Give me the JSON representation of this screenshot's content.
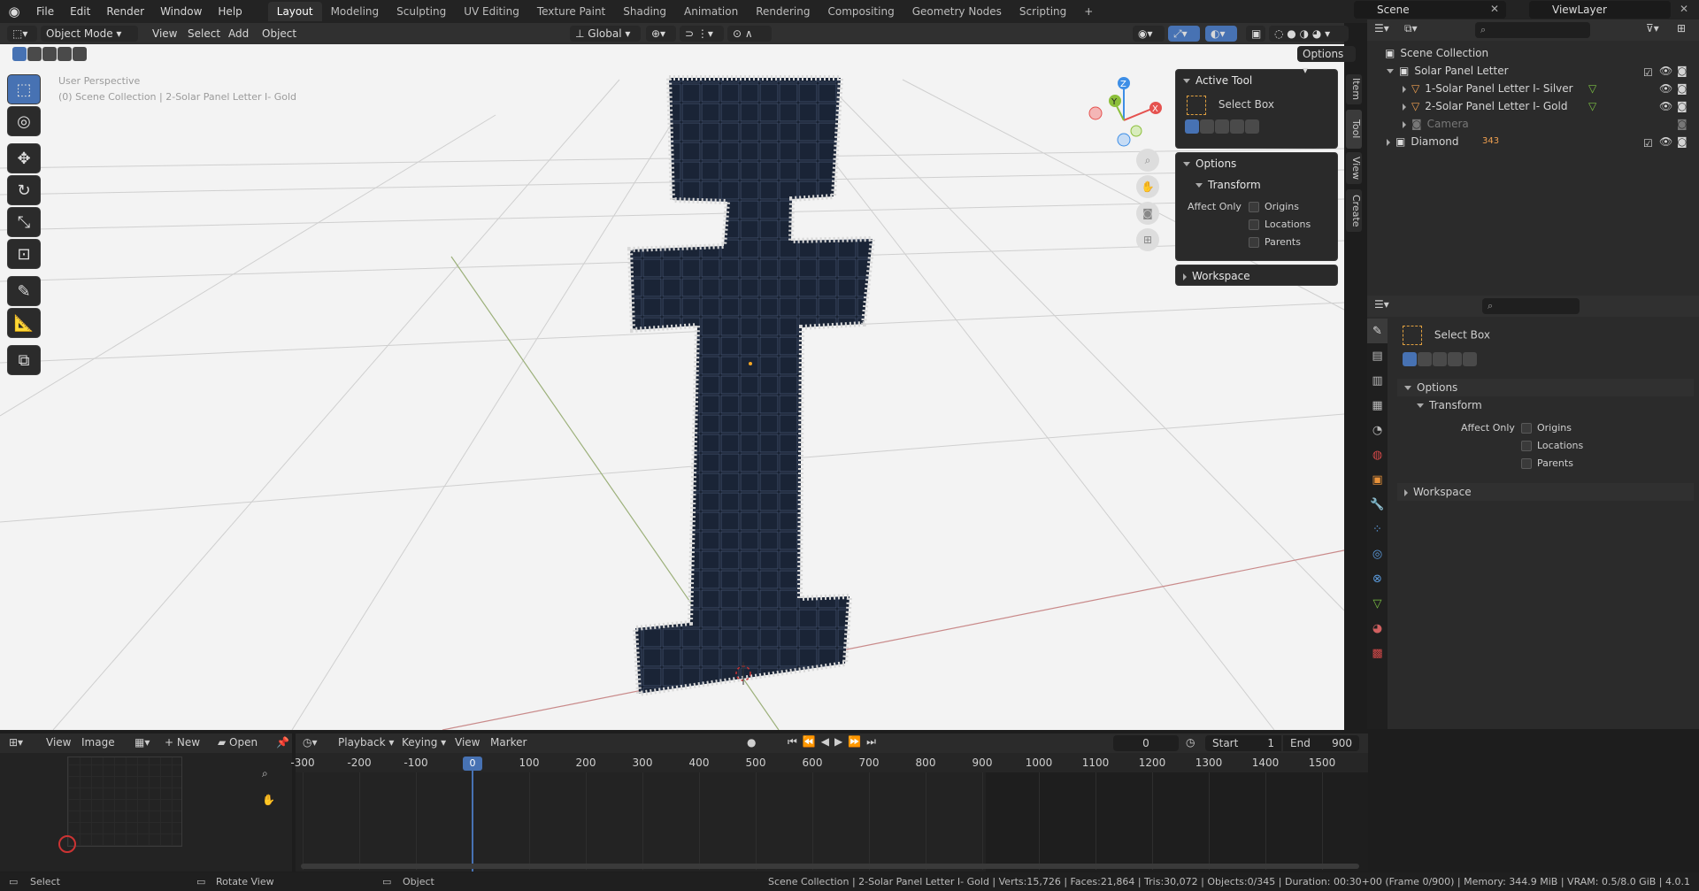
{
  "topbar": {
    "menus": [
      "File",
      "Edit",
      "Render",
      "Window",
      "Help"
    ],
    "workspaces": [
      "Layout",
      "Modeling",
      "Sculpting",
      "UV Editing",
      "Texture Paint",
      "Shading",
      "Animation",
      "Rendering",
      "Compositing",
      "Geometry Nodes",
      "Scripting"
    ],
    "active_workspace": "Layout",
    "add_workspace": "+",
    "scene": "Scene",
    "view_layer": "ViewLayer"
  },
  "viewport_header": {
    "mode": "Object Mode",
    "menus": [
      "View",
      "Select",
      "Add",
      "Object"
    ],
    "transform_orientation": "Global",
    "options_button": "Options"
  },
  "viewport": {
    "perspective_label": "User Perspective",
    "collection_label": "(0) Scene Collection | 2-Solar Panel Letter I- Gold",
    "gizmo": {
      "x": "X",
      "y": "Y",
      "z": "Z"
    },
    "side_tabs": [
      "Item",
      "Tool",
      "View",
      "Create"
    ]
  },
  "n_panel": {
    "active_tool_title": "Active Tool",
    "tool_name": "Select Box",
    "options_title": "Options",
    "transform_title": "Transform",
    "affect_only": "Affect Only",
    "origins": "Origins",
    "locations": "Locations",
    "parents": "Parents",
    "workspace_title": "Workspace"
  },
  "outliner": {
    "search_placeholder": "",
    "rows": [
      {
        "label": "Scene Collection"
      },
      {
        "label": "Solar Panel Letter"
      },
      {
        "label": "1-Solar Panel Letter I- Silver"
      },
      {
        "label": "2-Solar Panel Letter I- Gold"
      },
      {
        "label": "Camera"
      },
      {
        "label": "Diamond",
        "badge": "343"
      }
    ]
  },
  "properties": {
    "tool_name": "Select Box",
    "options_title": "Options",
    "transform_title": "Transform",
    "affect_only": "Affect Only",
    "origins": "Origins",
    "locations": "Locations",
    "parents": "Parents",
    "workspace_title": "Workspace"
  },
  "image_editor": {
    "menus": [
      "View",
      "Image"
    ],
    "new_label": "New",
    "open_label": "Open"
  },
  "timeline": {
    "menus": [
      "Playback",
      "Keying",
      "View",
      "Marker"
    ],
    "current_frame": "0",
    "start_label": "Start",
    "start_value": "1",
    "end_label": "End",
    "end_value": "900",
    "ruler": [
      "-300",
      "-200",
      "-100",
      "0",
      "100",
      "200",
      "300",
      "400",
      "500",
      "600",
      "700",
      "800",
      "900",
      "1000",
      "1100",
      "1200",
      "1300",
      "1400",
      "1500"
    ],
    "playhead": "0"
  },
  "statusbar": {
    "left": [
      "Select",
      "Rotate View",
      "Object"
    ],
    "stats": "Scene Collection | 2-Solar Panel Letter I- Gold | Verts:15,726 | Faces:21,864 | Tris:30,072 | Objects:0/345 | Duration: 00:30+00 (Frame 0/900) | Memory: 344.9 MiB | VRAM: 0.5/8.0 GiB | 4.0.1"
  },
  "colors": {
    "accent": "#4772b3",
    "selected_row": "#334d80",
    "viewport_bg": "#f3f3f3",
    "x_axis": "#e5524f",
    "y_axis": "#8cbf3a",
    "z_axis": "#3d8ee6"
  }
}
